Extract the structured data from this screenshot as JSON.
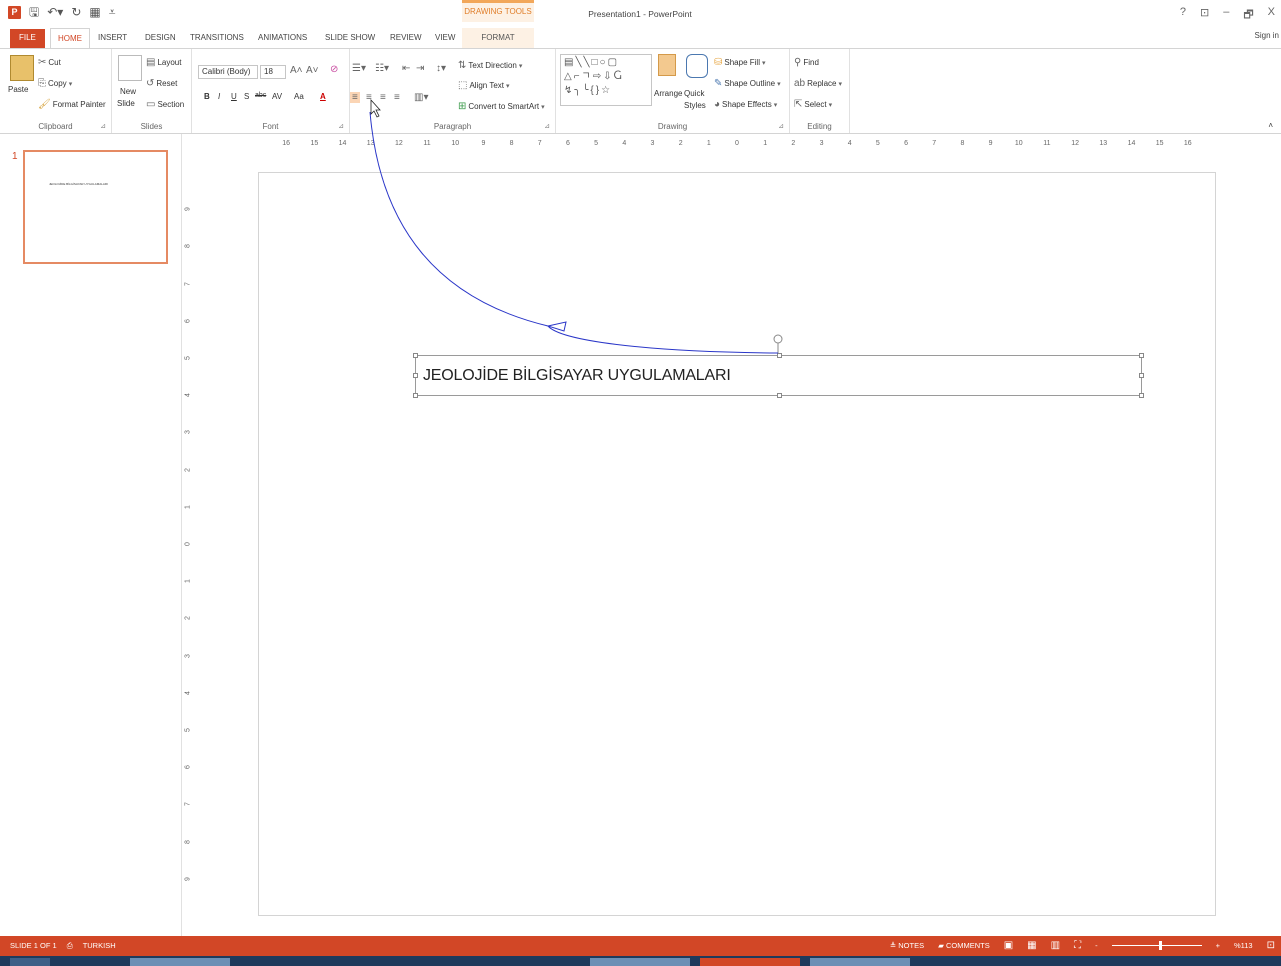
{
  "titlebar": {
    "drawing_tools": "DRAWING TOOLS",
    "window_title": "Presentation1 - PowerPoint",
    "help": "?",
    "restore_ribbon": "⊡",
    "minimize": "–",
    "maximize": "🗗",
    "close": "X"
  },
  "tabs": {
    "file": "FILE",
    "home": "HOME",
    "insert": "INSERT",
    "design": "DESIGN",
    "transitions": "TRANSITIONS",
    "animations": "ANIMATIONS",
    "slideshow": "SLIDE SHOW",
    "review": "REVIEW",
    "view": "VIEW",
    "format": "FORMAT",
    "sign_in": "Sign in"
  },
  "ribbon": {
    "clipboard": {
      "label": "Clipboard",
      "paste": "Paste",
      "cut": "Cut",
      "copy": "Copy",
      "format_painter": "Format Painter"
    },
    "slides": {
      "label": "Slides",
      "new_slide_1": "New",
      "new_slide_2": "Slide",
      "layout": "Layout",
      "reset": "Reset",
      "section": "Section"
    },
    "font": {
      "label": "Font",
      "font_name": "Calibri (Body)",
      "font_size": "18",
      "bold": "B",
      "italic": "I",
      "underline": "U",
      "shadow": "S",
      "strikethrough": "abc",
      "spacing": "AV",
      "change_case": "Aa",
      "font_color": "A"
    },
    "paragraph": {
      "label": "Paragraph",
      "text_direction": "Text Direction",
      "align_text": "Align Text",
      "convert_smartart": "Convert to SmartArt"
    },
    "drawing": {
      "label": "Drawing",
      "shapes_row1": "▤╲╲□○▢",
      "shapes_row2": "△⌐ㄱ⇨⇩Ⴚ",
      "shapes_row3": "↯╮╰{}☆",
      "arrange": "Arrange",
      "quick_styles_1": "Quick",
      "quick_styles_2": "Styles",
      "shape_fill": "Shape Fill",
      "shape_outline": "Shape Outline",
      "shape_effects": "Shape Effects"
    },
    "editing": {
      "label": "Editing",
      "find": "Find",
      "replace": "Replace",
      "select": "Select"
    }
  },
  "ruler_h": [
    "16",
    "15",
    "14",
    "13",
    "12",
    "11",
    "10",
    "9",
    "8",
    "7",
    "6",
    "5",
    "4",
    "3",
    "2",
    "1",
    "0",
    "1",
    "2",
    "3",
    "4",
    "5",
    "6",
    "7",
    "8",
    "9",
    "10",
    "11",
    "12",
    "13",
    "14",
    "15",
    "16"
  ],
  "ruler_v": [
    "9",
    "8",
    "7",
    "6",
    "5",
    "4",
    "3",
    "2",
    "1",
    "0",
    "1",
    "2",
    "3",
    "4",
    "5",
    "6",
    "7",
    "8",
    "9"
  ],
  "thumbnails": {
    "number": "1",
    "thumb_text": "JEOLOJİDE BİLGİSAYAR UYGULAMALARI"
  },
  "slide": {
    "textbox_text": "JEOLOJİDE BİLGİSAYAR UYGULAMALARI"
  },
  "statusbar": {
    "slide_info": "SLIDE 1 OF 1",
    "language": "TURKISH",
    "notes": "≜ NOTES",
    "comments": "COMMENTS",
    "zoom_minus": "-",
    "zoom_plus": "+",
    "zoom": "%113"
  }
}
